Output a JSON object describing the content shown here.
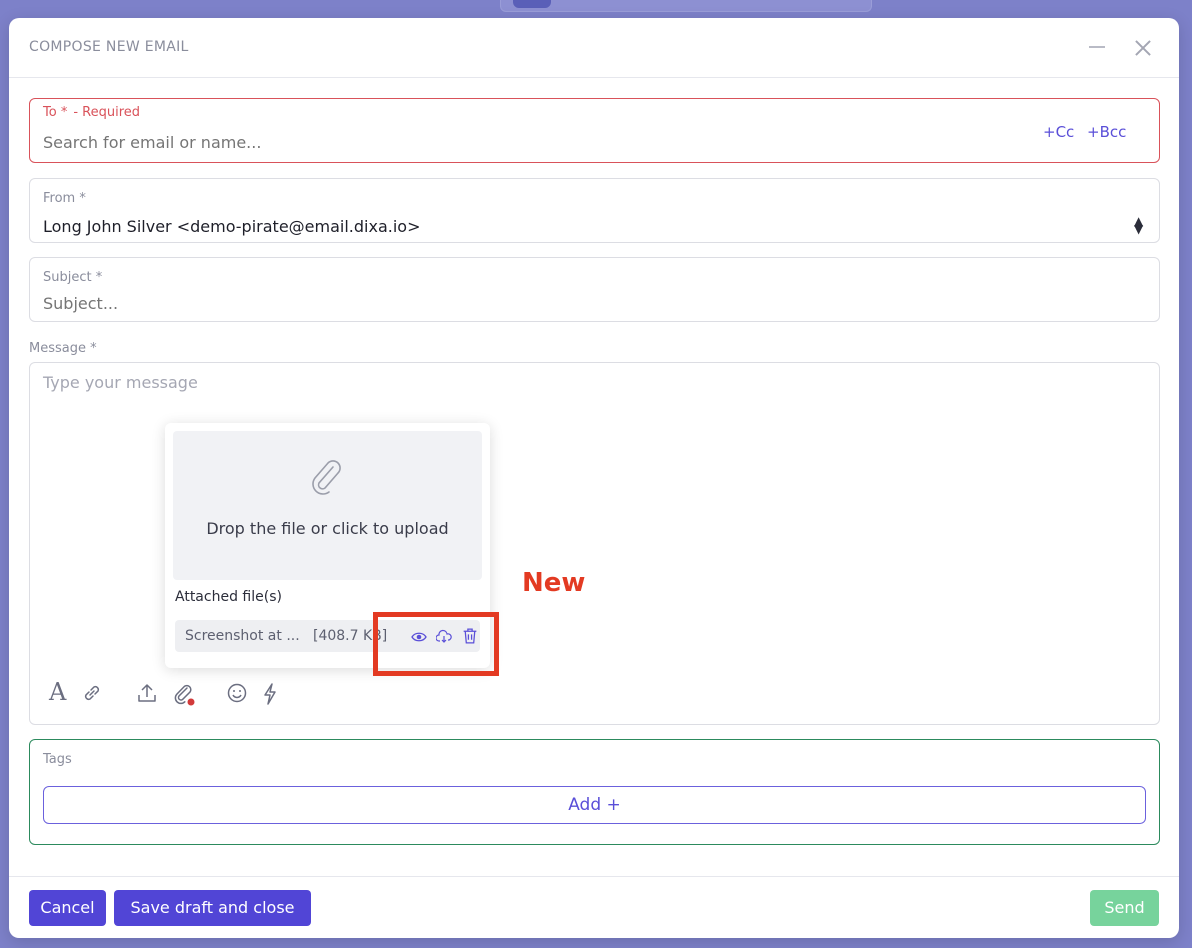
{
  "modal": {
    "title": "COMPOSE NEW EMAIL"
  },
  "to": {
    "label": "To *",
    "required_note": "- Required",
    "placeholder": "Search for email or name...",
    "cc_label": "+Cc",
    "bcc_label": "+Bcc"
  },
  "from": {
    "label": "From *",
    "value": "Long John Silver <demo-pirate@email.dixa.io>"
  },
  "subject": {
    "label": "Subject *",
    "placeholder": "Subject..."
  },
  "message": {
    "label": "Message *",
    "placeholder": "Type your message"
  },
  "upload": {
    "drop_text": "Drop the file or click to upload",
    "attached_label": "Attached file(s)",
    "file_name": "Screenshot at ...",
    "file_size": "[408.7 KB]"
  },
  "annotation": {
    "new_label": "New"
  },
  "tags": {
    "label": "Tags",
    "add_label": "Add +"
  },
  "footer": {
    "cancel_label": "Cancel",
    "save_label": "Save draft and close",
    "send_label": "Send"
  },
  "colors": {
    "accent": "#5145d6",
    "error": "#d9525a",
    "send": "#77d39c",
    "highlight": "#e33a22",
    "tags_border": "#2c8a5d"
  }
}
